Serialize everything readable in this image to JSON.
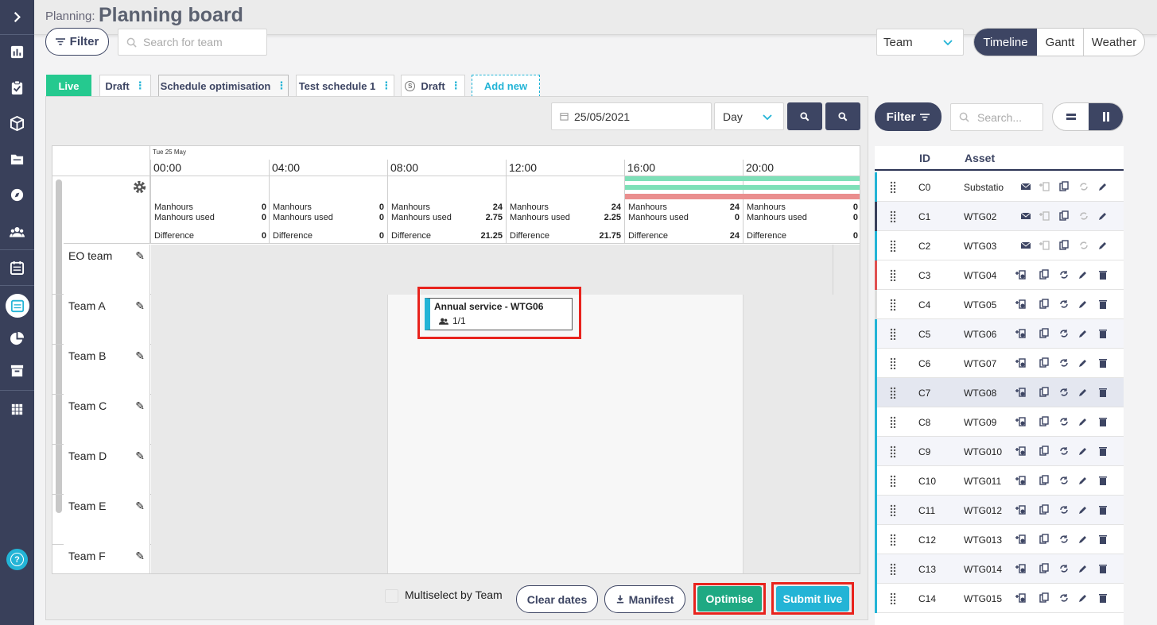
{
  "header": {
    "breadcrumb": "Planning:",
    "title": "Planning board"
  },
  "toolbar": {
    "filter_label": "Filter",
    "search_placeholder": "Search for team",
    "group_select": "Team",
    "views": [
      "Timeline",
      "Gantt",
      "Weather"
    ]
  },
  "tabs": [
    {
      "label": "Live",
      "state": "active"
    },
    {
      "label": "Draft"
    },
    {
      "label": "Schedule optimisation"
    },
    {
      "label": "Test schedule 1"
    },
    {
      "label": "Draft",
      "icon": "dollar-circle-icon"
    },
    {
      "label": "Add new"
    }
  ],
  "board": {
    "date": "25/05/2021",
    "range_select": "Day",
    "day_label": "Tue 25 May",
    "times": [
      "00:00",
      "04:00",
      "08:00",
      "12:00",
      "16:00",
      "20:00"
    ],
    "stat_labels": {
      "manhours": "Manhours",
      "used": "Manhours used",
      "diff": "Difference"
    },
    "stats": [
      {
        "manhours": "0",
        "used": "0",
        "diff": "0"
      },
      {
        "manhours": "0",
        "used": "0",
        "diff": "0"
      },
      {
        "manhours": "24",
        "used": "2.75",
        "diff": "21.25"
      },
      {
        "manhours": "24",
        "used": "2.25",
        "diff": "21.75"
      },
      {
        "manhours": "24",
        "used": "0",
        "diff": "24"
      },
      {
        "manhours": "0",
        "used": "0",
        "diff": "0"
      }
    ],
    "teams": [
      "EO team",
      "Team A",
      "Team B",
      "Team C",
      "Team D",
      "Team E",
      "Team F"
    ],
    "event": {
      "title": "Annual service - WTG06",
      "count": "1/1"
    },
    "footer": {
      "multiselect": "Multiselect by Team",
      "clear": "Clear dates",
      "manifest": "Manifest",
      "optimise": "Optimise",
      "submit": "Submit live"
    }
  },
  "right_panel": {
    "filter_label": "Filter",
    "search_placeholder": "Search...",
    "col_id": "ID",
    "col_asset": "Asset",
    "rows": [
      {
        "id": "C0",
        "asset": "Substatio",
        "mail": true
      },
      {
        "id": "C1",
        "asset": "WTG02",
        "mail": true
      },
      {
        "id": "C2",
        "asset": "WTG03",
        "mail": true
      },
      {
        "id": "C3",
        "asset": "WTG04"
      },
      {
        "id": "C4",
        "asset": "WTG05"
      },
      {
        "id": "C5",
        "asset": "WTG06"
      },
      {
        "id": "C6",
        "asset": "WTG07"
      },
      {
        "id": "C7",
        "asset": "WTG08"
      },
      {
        "id": "C8",
        "asset": "WTG09"
      },
      {
        "id": "C9",
        "asset": "WTG010"
      },
      {
        "id": "C10",
        "asset": "WTG011"
      },
      {
        "id": "C11",
        "asset": "WTG012"
      },
      {
        "id": "C12",
        "asset": "WTG013"
      },
      {
        "id": "C13",
        "asset": "WTG014"
      },
      {
        "id": "C14",
        "asset": "WTG015"
      }
    ]
  },
  "colors": {
    "nav": "#39405a",
    "accent": "#23b4d6",
    "live": "#25c98f",
    "navy": "#3d4563",
    "optimise": "#1fa983",
    "submit": "#23b4d6",
    "highlight": "#e8231d"
  }
}
